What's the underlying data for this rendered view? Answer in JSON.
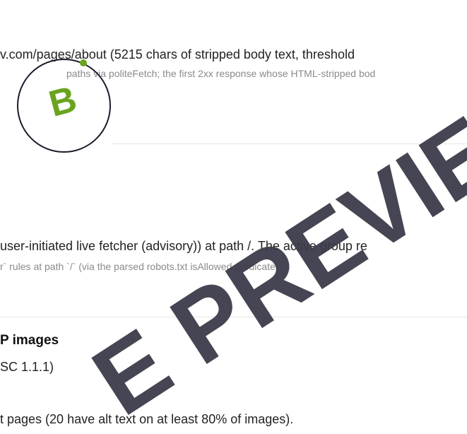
{
  "about_fetch": {
    "line": "v.com/pages/about (5215 chars of stripped body text, threshold",
    "detail": "paths via politeFetch; the first 2xx response whose HTML-stripped bod"
  },
  "badge": {
    "letter": "B"
  },
  "robots": {
    "line": "user-initiated live fetcher (advisory)) at path /. The active group re",
    "detail": "r` rules at path `/` (via the parsed robots.txt isAllowed predicate)."
  },
  "images_section": {
    "heading": "P images",
    "criterion": "SC 1.1.1)",
    "summary": "t pages (20 have alt text on at least 80% of images)."
  },
  "watermark": {
    "text": "E PREVIEW",
    "color": "#3b3b4a"
  }
}
